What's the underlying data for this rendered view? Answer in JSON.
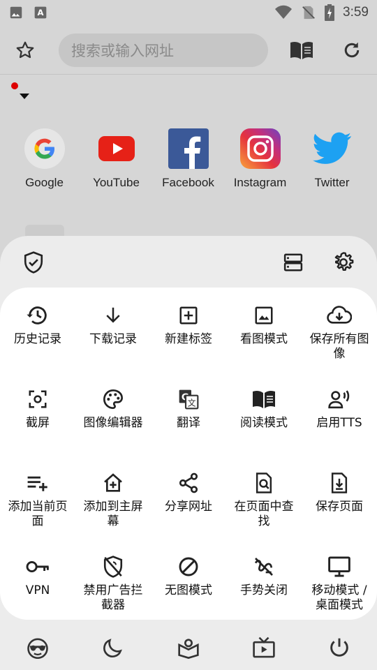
{
  "status_bar": {
    "time": "3:59",
    "icons": [
      "image-icon",
      "a-icon",
      "wifi-icon",
      "no-sim-icon",
      "battery-charging-icon"
    ]
  },
  "toolbar": {
    "search_placeholder": "搜索或输入网址",
    "icons": [
      "star-icon",
      "reader-mode-icon",
      "reload-icon"
    ]
  },
  "shortcuts": [
    {
      "label": "Google",
      "icon": "google-icon"
    },
    {
      "label": "YouTube",
      "icon": "youtube-icon"
    },
    {
      "label": "Facebook",
      "icon": "facebook-icon"
    },
    {
      "label": "Instagram",
      "icon": "instagram-icon"
    },
    {
      "label": "Twitter",
      "icon": "twitter-icon"
    }
  ],
  "sheet": {
    "top_icons": [
      "shield-check-icon",
      "storage-icon",
      "settings-gear-icon"
    ],
    "menu": [
      {
        "label": "历史记录",
        "icon": "history-icon"
      },
      {
        "label": "下载记录",
        "icon": "download-icon"
      },
      {
        "label": "新建标签",
        "icon": "new-tab-icon"
      },
      {
        "label": "看图模式",
        "icon": "image-view-icon"
      },
      {
        "label": "保存所有图像",
        "icon": "cloud-download-icon"
      },
      {
        "label": "截屏",
        "icon": "screenshot-icon"
      },
      {
        "label": "图像编辑器",
        "icon": "palette-icon"
      },
      {
        "label": "翻译",
        "icon": "translate-icon"
      },
      {
        "label": "阅读模式",
        "icon": "book-open-icon"
      },
      {
        "label": "启用TTS",
        "icon": "tts-icon"
      },
      {
        "label": "添加当前页面",
        "icon": "playlist-add-icon"
      },
      {
        "label": "添加到主屏幕",
        "icon": "add-home-icon"
      },
      {
        "label": "分享网址",
        "icon": "share-icon"
      },
      {
        "label": "在页面中查找",
        "icon": "find-in-page-icon"
      },
      {
        "label": "保存页面",
        "icon": "save-page-icon"
      },
      {
        "label": "VPN",
        "icon": "vpn-key-icon"
      },
      {
        "label": "禁用广告拦截器",
        "icon": "ad-block-off-icon"
      },
      {
        "label": "无图模式",
        "icon": "no-image-icon"
      },
      {
        "label": "手势关闭",
        "icon": "gesture-off-icon"
      },
      {
        "label": "移动模式 / 桌面模式",
        "icon": "desktop-icon"
      }
    ],
    "bottom_icons": [
      "incognito-icon",
      "night-mode-icon",
      "book-location-icon",
      "tv-play-icon",
      "power-icon"
    ]
  },
  "colors": {
    "background": "#d6d6d6",
    "sheet": "#ececec",
    "panel": "#ffffff",
    "notification_dot": "#dd0000"
  }
}
